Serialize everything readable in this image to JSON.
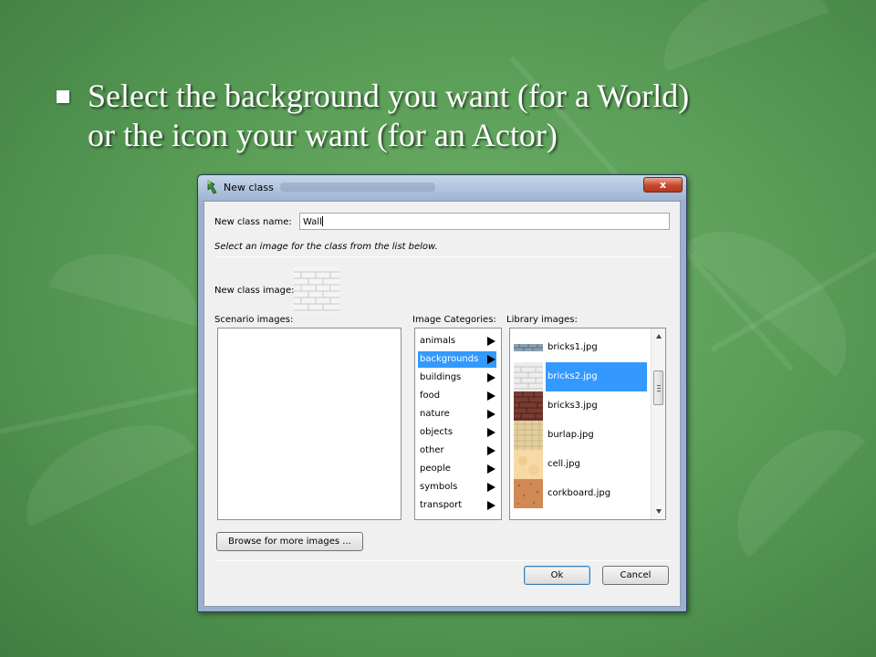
{
  "slide": {
    "bullet_line1": "Select the background you want (for a World)",
    "bullet_line2": "or the icon your want (for an Actor)"
  },
  "dialog": {
    "title": "New class",
    "close_glyph": "x",
    "name_label": "New class name:",
    "name_value": "Wall",
    "hint": "Select an image for the class from the list below.",
    "image_label": "New class image:",
    "scenario_label": "Scenario images:",
    "categories_label": "Image Categories:",
    "library_label": "Library images:",
    "categories": [
      {
        "label": "animals",
        "selected": false
      },
      {
        "label": "backgrounds",
        "selected": true
      },
      {
        "label": "buildings",
        "selected": false
      },
      {
        "label": "food",
        "selected": false
      },
      {
        "label": "nature",
        "selected": false
      },
      {
        "label": "objects",
        "selected": false
      },
      {
        "label": "other",
        "selected": false
      },
      {
        "label": "people",
        "selected": false
      },
      {
        "label": "symbols",
        "selected": false
      },
      {
        "label": "transport",
        "selected": false
      }
    ],
    "library": [
      {
        "label": "bricks1.jpg",
        "selected": false,
        "thumb_icon": "bricks-gray-thumb"
      },
      {
        "label": "bricks2.jpg",
        "selected": true,
        "thumb_icon": "bricks-white-thumb"
      },
      {
        "label": "bricks3.jpg",
        "selected": false,
        "thumb_icon": "bricks-red-thumb"
      },
      {
        "label": "burlap.jpg",
        "selected": false,
        "thumb_icon": "burlap-thumb"
      },
      {
        "label": "cell.jpg",
        "selected": false,
        "thumb_icon": "cell-thumb"
      },
      {
        "label": "corkboard.jpg",
        "selected": false,
        "thumb_icon": "corkboard-thumb"
      }
    ],
    "browse_button": "Browse for more images ...",
    "ok_button": "Ok",
    "cancel_button": "Cancel"
  },
  "colors": {
    "background": "#5a9e57",
    "selection": "#3399ff",
    "close_button": "#c8472b"
  }
}
